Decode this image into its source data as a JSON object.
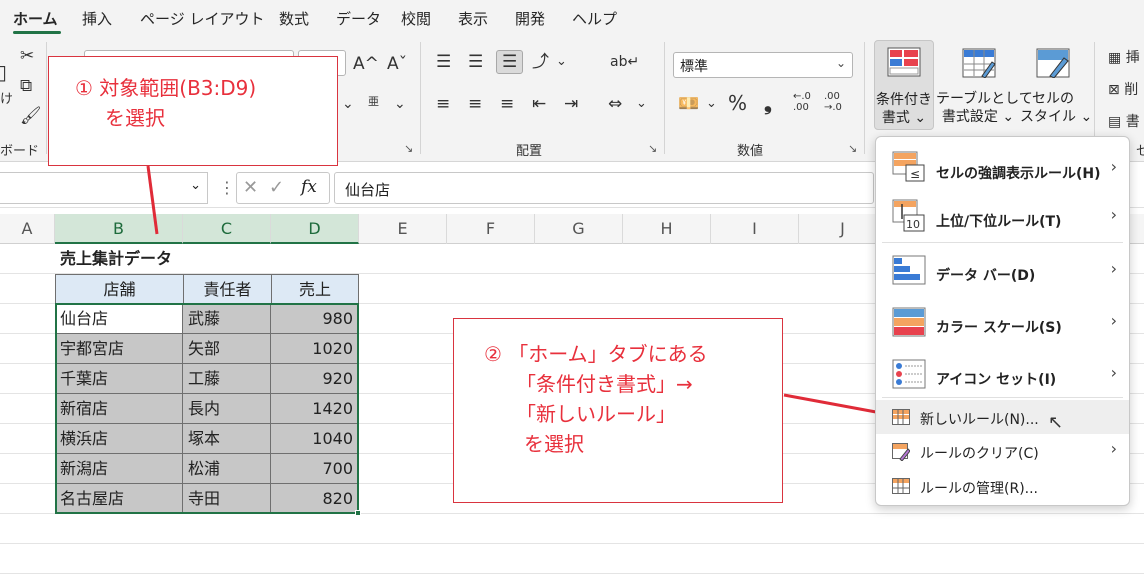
{
  "tabs": [
    "ホーム",
    "挿入",
    "ページ レイアウト",
    "数式",
    "データ",
    "校閲",
    "表示",
    "開発",
    "ヘルプ"
  ],
  "ribbon": {
    "clipboard_label": "ボード",
    "paste_partial": "け",
    "alignment_label": "配置",
    "number_label": "数値",
    "number_format": "標準",
    "percent": "%",
    "comma": "❟",
    "dec_inc": "←.0\n.00",
    "dec_dec": ".00\n→.0",
    "cf_label1": "条件付き",
    "cf_label2": "書式 ⌄",
    "table_label1": "テーブルとして",
    "table_label2": "書式設定 ⌄",
    "style_label1": "セルの",
    "style_label2": "スタイル ⌄",
    "cells_insert": "挿",
    "cells_delete": "削",
    "cells_format": "書",
    "cells_label": "セ",
    "font_grow": "A^",
    "font_shrink": "Aˇ",
    "phonetic": "亜"
  },
  "formula_bar": {
    "name_box": "",
    "fx": "fx",
    "value": "仙台店"
  },
  "columns": [
    "A",
    "B",
    "C",
    "D",
    "E",
    "F",
    "G",
    "H",
    "I",
    "J"
  ],
  "sheet": {
    "title": "売上集計データ",
    "headers": [
      "店舗",
      "責任者",
      "売上"
    ],
    "rows": [
      [
        "仙台店",
        "武藤",
        "980"
      ],
      [
        "宇都宮店",
        "矢部",
        "1020"
      ],
      [
        "千葉店",
        "工藤",
        "920"
      ],
      [
        "新宿店",
        "長内",
        "1420"
      ],
      [
        "横浜店",
        "塚本",
        "1040"
      ],
      [
        "新潟店",
        "松浦",
        "700"
      ],
      [
        "名古屋店",
        "寺田",
        "820"
      ]
    ]
  },
  "callout1": {
    "line1": "① 対象範囲(B3:D9)",
    "line2": "を選択"
  },
  "callout2": {
    "line1": "② 「ホーム」タブにある",
    "line2": "「条件付き書式」→",
    "line3": "「新しいルール」",
    "line4": "を選択"
  },
  "menu": {
    "items": [
      {
        "label": "セルの強調表示ルール(H)",
        "icon": "highlight-rules-icon"
      },
      {
        "label": "上位/下位ルール(T)",
        "icon": "top-bottom-icon"
      },
      {
        "label": "データ バー(D)",
        "icon": "data-bar-icon"
      },
      {
        "label": "カラー スケール(S)",
        "icon": "color-scale-icon"
      },
      {
        "label": "アイコン セット(I)",
        "icon": "icon-set-icon"
      }
    ],
    "new_rule": "新しいルール(N)...",
    "clear_rules": "ルールのクリア(C)",
    "manage_rules": "ルールの管理(R)..."
  },
  "colors": {
    "accent": "#217346",
    "callout": "#e8303c",
    "header_fill": "#dde9f5",
    "selection_fill": "#c7c7c7"
  }
}
